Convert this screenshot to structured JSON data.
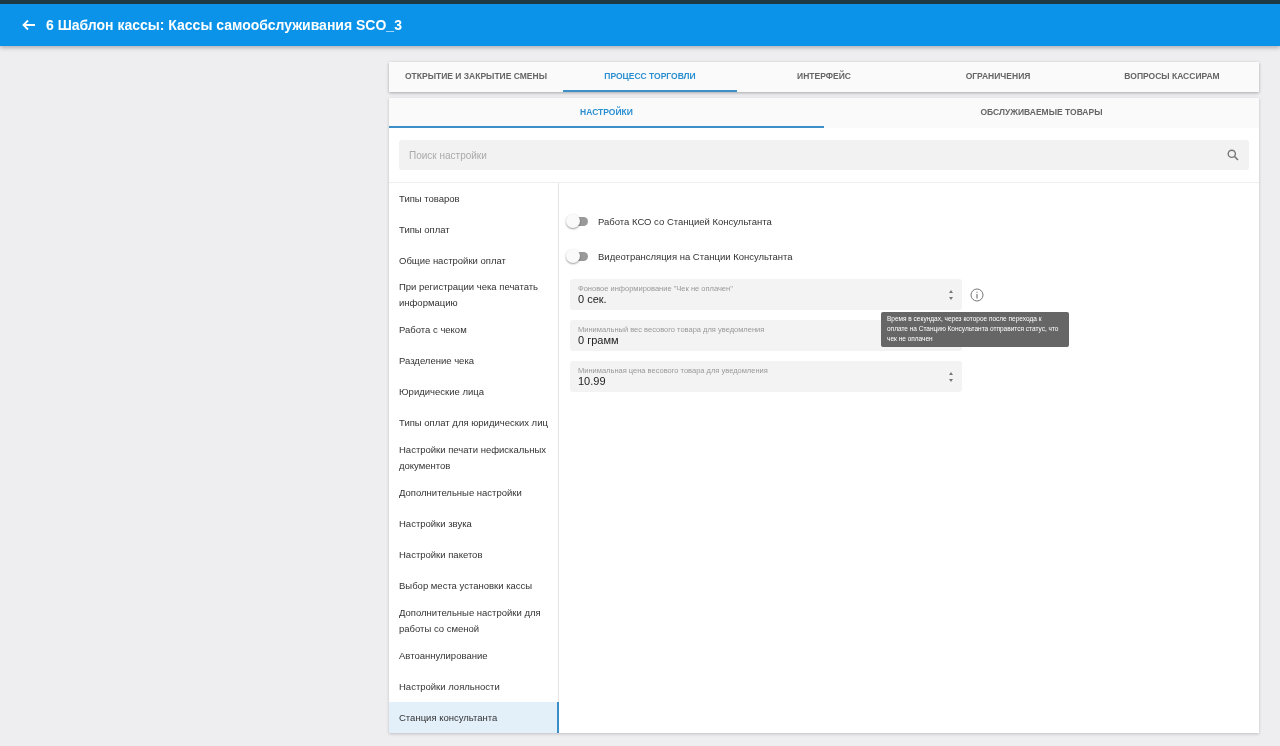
{
  "header": {
    "title": "6 Шаблон кассы: Кассы самообслуживания SCO_3"
  },
  "tabs": [
    {
      "label": "ОТКРЫТИЕ И ЗАКРЫТИЕ СМЕНЫ",
      "selected": false
    },
    {
      "label": "ПРОЦЕСС ТОРГОВЛИ",
      "selected": true
    },
    {
      "label": "ИНТЕРФЕЙС",
      "selected": false
    },
    {
      "label": "ОГРАНИЧЕНИЯ",
      "selected": false
    },
    {
      "label": "ВОПРОСЫ КАССИРАМ",
      "selected": false
    }
  ],
  "subtabs": [
    {
      "label": "НАСТРОЙКИ",
      "selected": true
    },
    {
      "label": "ОБСЛУЖИВАЕМЫЕ ТОВАРЫ",
      "selected": false
    }
  ],
  "search": {
    "placeholder": "Поиск настройки"
  },
  "sidebar": {
    "items": [
      {
        "label": "Типы товаров",
        "selected": false
      },
      {
        "label": "Типы оплат",
        "selected": false
      },
      {
        "label": "Общие настройки оплат",
        "selected": false
      },
      {
        "label": "При регистрации чека печатать информацию",
        "selected": false
      },
      {
        "label": "Работа с чеком",
        "selected": false
      },
      {
        "label": "Разделение чека",
        "selected": false
      },
      {
        "label": "Юридические лица",
        "selected": false
      },
      {
        "label": "Типы оплат для юридических лиц",
        "selected": false
      },
      {
        "label": "Настройки печати нефискальных документов",
        "selected": false
      },
      {
        "label": "Дополнительные настройки",
        "selected": false
      },
      {
        "label": "Настройки звука",
        "selected": false
      },
      {
        "label": "Настройки пакетов",
        "selected": false
      },
      {
        "label": "Выбор места установки кассы",
        "selected": false
      },
      {
        "label": "Дополнительные настройки для работы со сменой",
        "selected": false
      },
      {
        "label": "Автоаннулирование",
        "selected": false
      },
      {
        "label": "Настройки лояльности",
        "selected": false
      },
      {
        "label": "Станция консультанта",
        "selected": true
      }
    ]
  },
  "settings": [
    {
      "kind": "toggle",
      "label": "Работа КСО со Станцией Консультанта",
      "on": false
    },
    {
      "kind": "toggle",
      "label": "Видеотрансляция на Станции Консультанта",
      "on": false
    },
    {
      "kind": "number",
      "label": "Фоновое информирование \"Чек не оплачен\"",
      "value": "0 сек.",
      "tooltip": "Время в секундах, через которое после перехода к оплате на Станцию Консультанта отправится статус, что чек не оплачен"
    },
    {
      "kind": "number",
      "label": "Минимальный вес весового товара для уведомления",
      "value": "0 грамм"
    },
    {
      "kind": "number",
      "label": "Минимальная цена весового товара для уведомления",
      "value": "10.99"
    }
  ]
}
